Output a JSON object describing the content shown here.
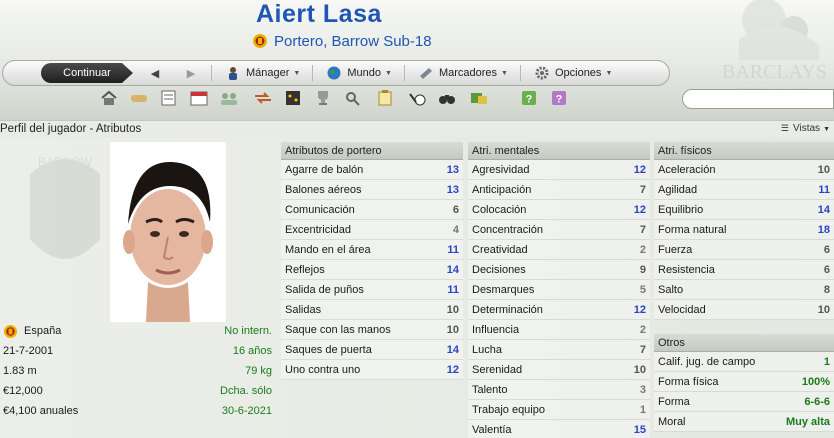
{
  "player": {
    "name": "Aiert Lasa",
    "role": "Portero, Barrow Sub-18"
  },
  "nav": {
    "continue": "Continuar",
    "back_icon": "back-arrow-icon",
    "forward_icon": "forward-arrow-icon",
    "menus": [
      {
        "label": "Mánager",
        "icon": "manager-icon"
      },
      {
        "label": "Mundo",
        "icon": "globe-icon"
      },
      {
        "label": "Marcadores",
        "icon": "bookmark-icon"
      },
      {
        "label": "Opciones",
        "icon": "options-icon"
      }
    ]
  },
  "page": {
    "title": "Perfil del jugador - Atributos",
    "views": "Vistas"
  },
  "info": {
    "nation": "España",
    "nation_status": "No intern.",
    "dob": "21-7-2001",
    "age": "16 años",
    "height": "1.83 m",
    "weight": "79 kg",
    "value": "€12,000",
    "foot": "Dcha. sólo",
    "wage": "€4,100 anuales",
    "contract_end": "30-6-2021"
  },
  "panels": {
    "goalkeeper": {
      "title": "Atributos de portero",
      "rows": [
        {
          "label": "Agarre de balón",
          "value": "13"
        },
        {
          "label": "Balones aéreos",
          "value": "13"
        },
        {
          "label": "Comunicación",
          "value": "6"
        },
        {
          "label": "Excentricidad",
          "value": "4"
        },
        {
          "label": "Mando en el área",
          "value": "11"
        },
        {
          "label": "Reflejos",
          "value": "14"
        },
        {
          "label": "Salida de puños",
          "value": "11"
        },
        {
          "label": "Salidas",
          "value": "10"
        },
        {
          "label": "Saque con las manos",
          "value": "10"
        },
        {
          "label": "Saques de puerta",
          "value": "14"
        },
        {
          "label": "Uno contra uno",
          "value": "12"
        }
      ]
    },
    "mental": {
      "title": "Atri. mentales",
      "rows": [
        {
          "label": "Agresividad",
          "value": "12"
        },
        {
          "label": "Anticipación",
          "value": "7"
        },
        {
          "label": "Colocación",
          "value": "12"
        },
        {
          "label": "Concentración",
          "value": "7"
        },
        {
          "label": "Creatividad",
          "value": "2"
        },
        {
          "label": "Decisiones",
          "value": "9"
        },
        {
          "label": "Desmarques",
          "value": "5"
        },
        {
          "label": "Determinación",
          "value": "12"
        },
        {
          "label": "Influencia",
          "value": "2"
        },
        {
          "label": "Lucha",
          "value": "7"
        },
        {
          "label": "Serenidad",
          "value": "10"
        },
        {
          "label": "Talento",
          "value": "3"
        },
        {
          "label": "Trabajo equipo",
          "value": "1"
        },
        {
          "label": "Valentía",
          "value": "15"
        }
      ]
    },
    "physical": {
      "title": "Atri. físicos",
      "rows": [
        {
          "label": "Aceleración",
          "value": "10"
        },
        {
          "label": "Agilidad",
          "value": "11"
        },
        {
          "label": "Equilibrio",
          "value": "14"
        },
        {
          "label": "Forma natural",
          "value": "18"
        },
        {
          "label": "Fuerza",
          "value": "6"
        },
        {
          "label": "Resistencia",
          "value": "6"
        },
        {
          "label": "Salto",
          "value": "8"
        },
        {
          "label": "Velocidad",
          "value": "10"
        }
      ]
    },
    "others": {
      "title": "Otros",
      "rows": [
        {
          "label": "Calif. jug. de campo",
          "value": "1"
        },
        {
          "label": "Forma física",
          "value": "100%"
        },
        {
          "label": "Forma",
          "value": "6-6-6"
        },
        {
          "label": "Moral",
          "value": "Muy alta"
        }
      ]
    }
  },
  "colors": {
    "name_blue": "#1f55b3",
    "value_blue": "#2a44c8",
    "value_green": "#1b7a1b"
  }
}
